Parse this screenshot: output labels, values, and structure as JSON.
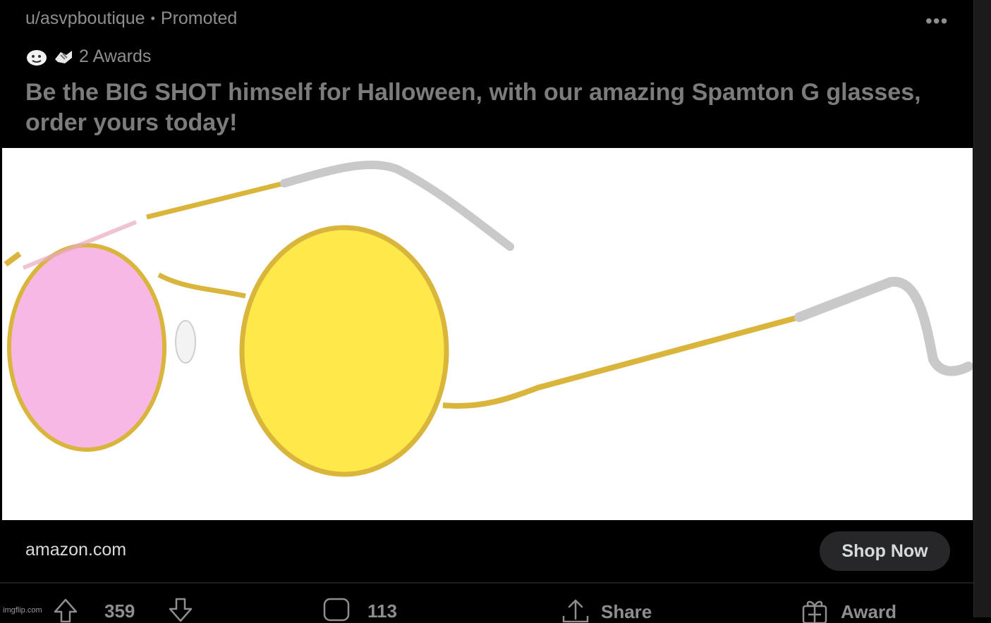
{
  "post": {
    "author": "u/asvpboutique",
    "separator": "•",
    "promoted_label": "Promoted",
    "awards_count_label": "2 Awards",
    "title": "Be the BIG SHOT himself for Halloween, with our amazing Spamton G glasses, order yours today!",
    "more_icon": "more-options-icon"
  },
  "ad": {
    "domain": "amazon.com",
    "cta_label": "Shop Now"
  },
  "actions": {
    "score": "359",
    "comments": "113",
    "share_label": "Share",
    "award_label": "Award"
  },
  "watermark": "imgflip.com",
  "colors": {
    "background": "#000000",
    "muted_text": "#8e8e8e",
    "button_bg": "#272729",
    "lens_pink": "#f8b8e6",
    "lens_yellow": "#ffe94a",
    "frame_gold": "#d9b53c"
  }
}
